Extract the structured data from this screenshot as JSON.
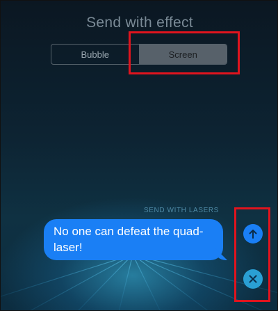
{
  "header": {
    "title": "Send with effect",
    "tabs": [
      {
        "label": "Bubble",
        "selected": false
      },
      {
        "label": "Screen",
        "selected": true
      }
    ]
  },
  "effect": {
    "caption": "SEND WITH LASERS"
  },
  "message": {
    "text": "No one can defeat the quad-laser!",
    "bubble_color": "#1a7ff5"
  },
  "actions": {
    "send_icon": "arrow-up-icon",
    "cancel_icon": "close-icon"
  },
  "annotations": {
    "highlight_color": "#e0141e"
  }
}
